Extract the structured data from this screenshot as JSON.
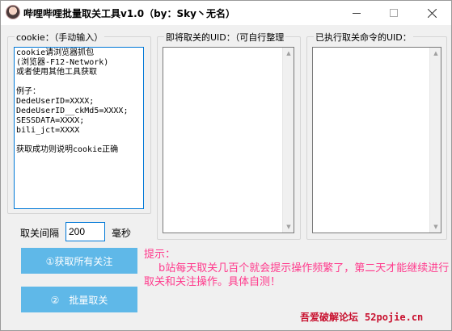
{
  "window": {
    "title": "哔哩哔哩批量取关工具v1.0（by：Sky丶无名）",
    "controls": {
      "minimize": "minimize-icon",
      "maximize": "maximize-icon",
      "close": "close-icon"
    }
  },
  "cookie_group": {
    "label": "cookie：（手动输入）",
    "lines": [
      "cookie请浏览器抓包",
      "(浏览器-F12-Network)",
      "或者使用其他工具获取",
      "",
      "例子：",
      "DedeUserID=XXXX;",
      "DedeUserID__ckMd5=XXXX;",
      "SESSDATA=XXXX;",
      "bili_jct=XXXX",
      "",
      "获取成功则说明cookie正确"
    ]
  },
  "pending_group": {
    "label": "即将取关的UID：（可自行整理"
  },
  "done_group": {
    "label": "已执行取关命令的UID："
  },
  "interval": {
    "label": "取关间隔",
    "value": "200",
    "unit": "毫秒"
  },
  "buttons": {
    "get_follows": "①获取所有关注",
    "batch_unfollow": "②　批量取关"
  },
  "tip": {
    "title": "提示：",
    "body": "b站每天取关几百个就会提示操作频繁了，第二天才能继续进行取关和关注操作。具体自测！"
  },
  "footer": {
    "forum": "吾爱破解论坛",
    "site": "52pojie.cn"
  },
  "colors": {
    "button": "#5fb8e8",
    "tip_text": "#ff3a8c",
    "footer_text": "#c8102e",
    "focus_border": "#0078d7"
  }
}
